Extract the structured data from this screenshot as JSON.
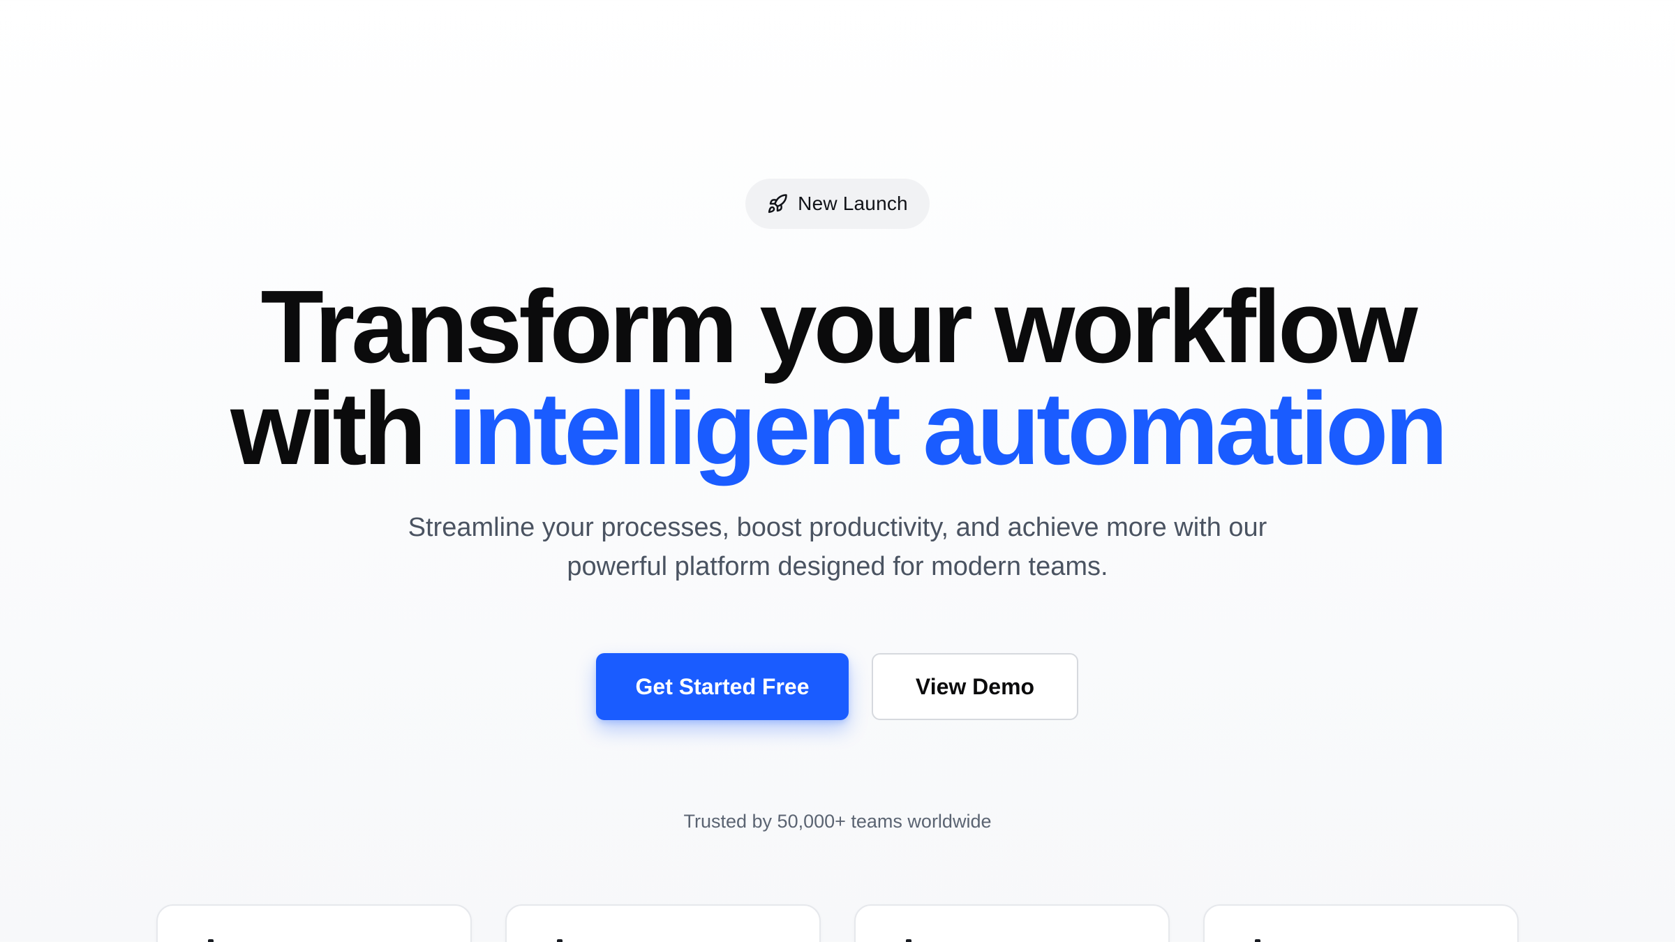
{
  "badge": {
    "icon": "rocket-icon",
    "label": "New Launch"
  },
  "headline": {
    "line1": "Transform your workflow",
    "line2_plain": "with ",
    "line2_accent": "intelligent automation"
  },
  "subtitle": {
    "line1": "Streamline your processes, boost productivity, and achieve more with our",
    "line2": "powerful platform designed for modern teams."
  },
  "buttons": {
    "primary_label": "Get Started Free",
    "secondary_label": "View Demo"
  },
  "social_proof": {
    "text": "Trusted by 50,000+ teams worldwide"
  },
  "colors": {
    "accent": "#1a5cff",
    "heading": "#0b0b0c",
    "body_text": "#4a5361",
    "muted_text": "#5b6472",
    "badge_bg": "#f1f2f4"
  },
  "feature_cards": {
    "count_visible": 4
  }
}
